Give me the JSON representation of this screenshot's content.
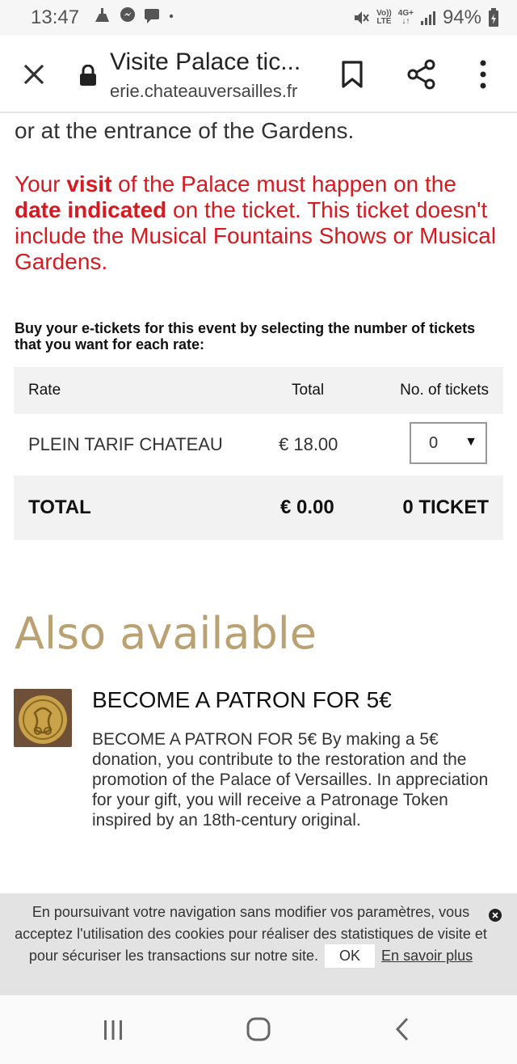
{
  "status_bar": {
    "time": "13:47",
    "network_volte": "Vo))",
    "network_lte": "LTE",
    "network_type": "4G+",
    "battery": "94%"
  },
  "toolbar": {
    "title": "Visite Palace tic...",
    "url": "erie.chateauversailles.fr"
  },
  "content": {
    "prev_text": "or at the entrance of the Gardens.",
    "warning": {
      "part1": "Your ",
      "bold1": "visit",
      "part2": " of the Palace must happen on the ",
      "bold2": "date indicated",
      "part3": " on the ticket. This ticket doesn't include the Musical Fountains Shows or Musical Gardens."
    },
    "intro": "Buy your e-tickets for this event by selecting the number of tickets that you want for each rate:",
    "table": {
      "headers": {
        "rate": "Rate",
        "total": "Total",
        "tickets": "No. of tickets"
      },
      "rows": [
        {
          "rate": "PLEIN TARIF CHATEAU",
          "total": "€ 18.00",
          "quantity": "0"
        }
      ],
      "summary": {
        "label": "TOTAL",
        "amount": "€ 0.00",
        "count": "0 TICKET"
      }
    },
    "also_available": {
      "title": "Also available",
      "product": {
        "title": "BECOME A PATRON FOR 5€",
        "description": "BECOME A PATRON FOR 5€ By making a 5€ donation, you contribute to the restoration and the promotion of the Palace of Versailles. In appreciation for your gift, you will receive a Patronage Token inspired by an 18th-century original."
      }
    }
  },
  "cookie": {
    "text": "En poursuivant votre navigation sans modifier vos paramètres, vous acceptez l'utilisation des cookies pour réaliser des statistiques de visite et pour sécuriser les transactions sur notre site.",
    "ok_label": "OK",
    "more_label": "En savoir plus"
  },
  "colors": {
    "warning_red": "#d71920",
    "gold": "#b9a171",
    "table_bg": "#f2f2f2",
    "cookie_bg": "#e3e3e3"
  }
}
